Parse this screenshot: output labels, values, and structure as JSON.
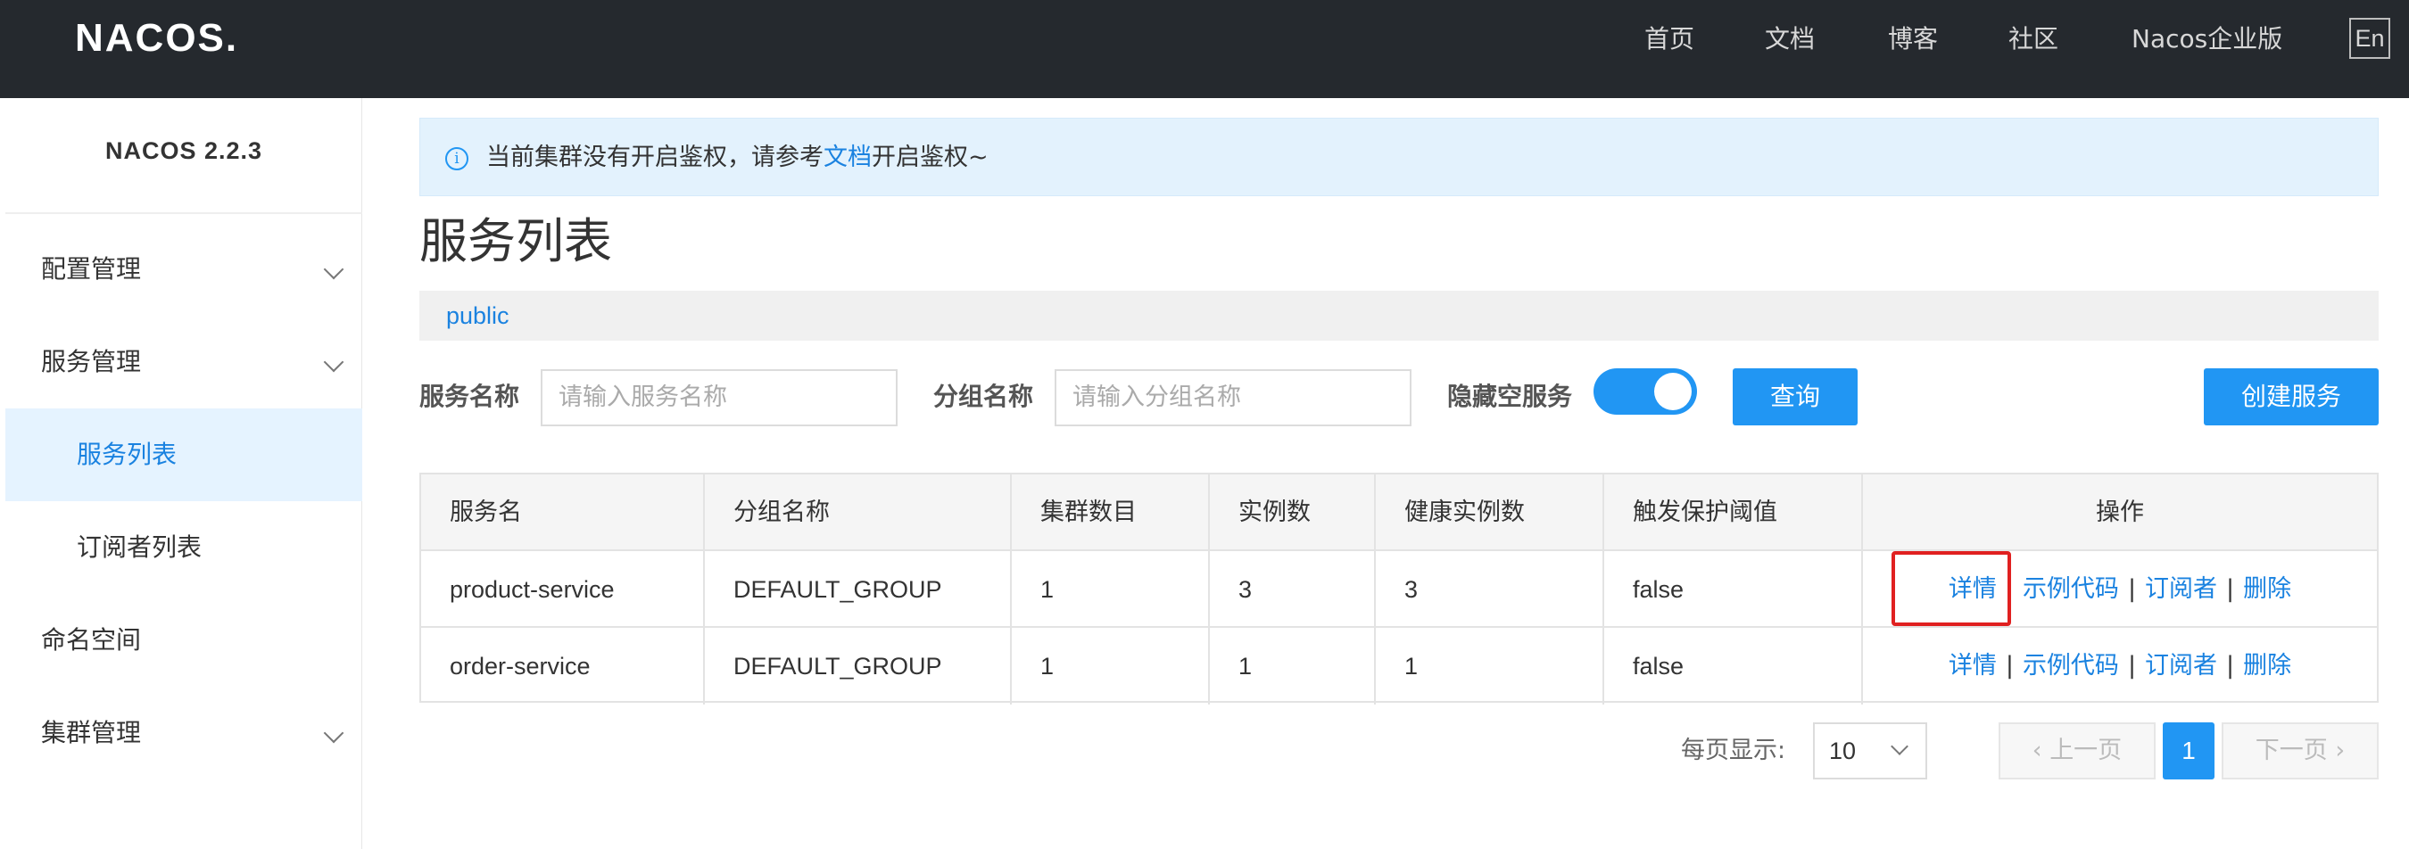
{
  "header": {
    "logo": "NACOS.",
    "nav": [
      "首页",
      "文档",
      "博客",
      "社区",
      "Nacos企业版"
    ],
    "lang_button": "En"
  },
  "sidebar": {
    "version": "NACOS 2.2.3",
    "items": [
      {
        "label": "配置管理",
        "expandable": true
      },
      {
        "label": "服务管理",
        "expandable": true
      },
      {
        "label": "服务列表",
        "active": true
      },
      {
        "label": "订阅者列表"
      },
      {
        "label": "命名空间"
      },
      {
        "label": "集群管理",
        "expandable": true
      }
    ]
  },
  "notice": {
    "before": "当前集群没有开启鉴权，请参考",
    "link": "文档",
    "after": "开启鉴权~"
  },
  "page": {
    "title": "服务列表",
    "namespace": "public"
  },
  "filters": {
    "service_name_label": "服务名称",
    "service_name_placeholder": "请输入服务名称",
    "group_name_label": "分组名称",
    "group_name_placeholder": "请输入分组名称",
    "hide_empty_label": "隐藏空服务",
    "hide_empty_on": true,
    "query_button": "查询",
    "create_button": "创建服务"
  },
  "table": {
    "columns": [
      "服务名",
      "分组名称",
      "集群数目",
      "实例数",
      "健康实例数",
      "触发保护阈值",
      "操作"
    ],
    "rows": [
      [
        "product-service",
        "DEFAULT_GROUP",
        "1",
        "3",
        "3",
        "false"
      ],
      [
        "order-service",
        "DEFAULT_GROUP",
        "1",
        "1",
        "1",
        "false"
      ]
    ],
    "actions": [
      "详情",
      "示例代码",
      "订阅者",
      "删除"
    ],
    "action_separator": "|"
  },
  "pagination": {
    "page_size_label": "每页显示:",
    "page_size": "10",
    "prev": "上一页",
    "current": "1",
    "next": "下一页"
  },
  "colors": {
    "topbar": "#25292e",
    "accent": "#2196f3",
    "link": "#1a82e0",
    "highlight_box": "#e02020"
  }
}
